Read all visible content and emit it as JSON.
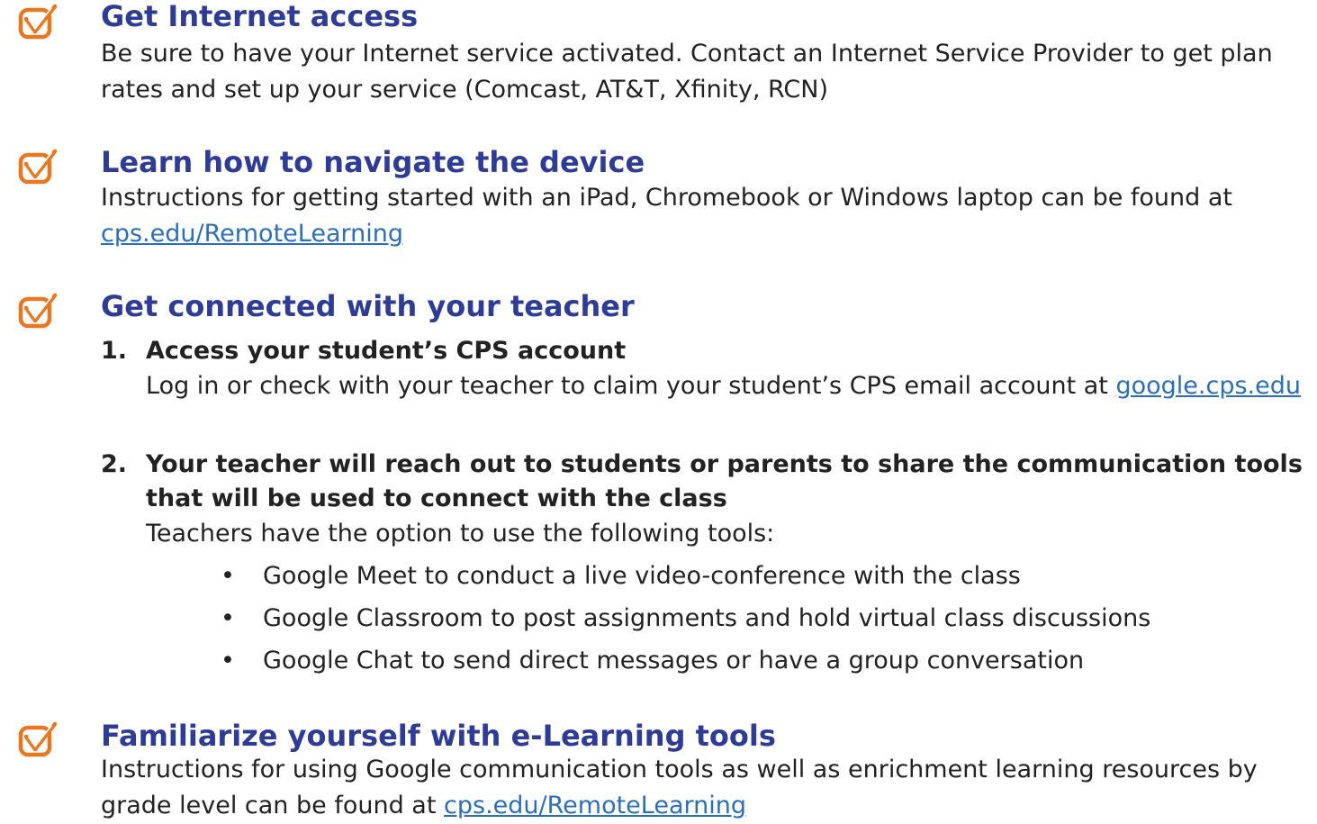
{
  "colors": {
    "heading": "#2f3c96",
    "check_icon": "#e87722",
    "link": "#2c6fb7",
    "body_text": "#222222"
  },
  "sections": [
    {
      "icon": "checkbox-check-icon",
      "heading": "Get Internet access",
      "text": "Be sure to have your Internet service activated. Contact an Internet Service Provider to get plan rates and set up your service (Comcast, AT&T, Xfinity, RCN)"
    },
    {
      "icon": "checkbox-check-icon",
      "heading": "Learn how to navigate the device",
      "text": "Instructions for getting started with an iPad, Chromebook or Windows laptop can be found at ",
      "link": "cps.edu/RemoteLearning"
    },
    {
      "icon": "checkbox-check-icon",
      "heading": "Get connected with your teacher",
      "items": [
        {
          "number": "1.",
          "title": "Access your student’s CPS account",
          "text": "Log in or check with your teacher to claim your student’s CPS email account at ",
          "link": "google.cps.edu"
        },
        {
          "number": "2.",
          "title": "Your teacher will reach out to students or parents to share the communication tools that will be used to connect with the class",
          "text": "Teachers have the option to use the following tools:",
          "bullets": [
            "Google Meet to conduct a live video-conference with the class",
            "Google Classroom to post assignments and hold virtual class discussions",
            "Google Chat to send direct messages or have a group conversation"
          ],
          "bullet_glyph": "•"
        }
      ]
    },
    {
      "icon": "checkbox-check-icon",
      "heading": "Familiarize yourself with e-Learning tools",
      "text": "Instructions for using Google communication tools as well as enrichment learning resources by grade level can be found at ",
      "link": "cps.edu/RemoteLearning"
    }
  ]
}
